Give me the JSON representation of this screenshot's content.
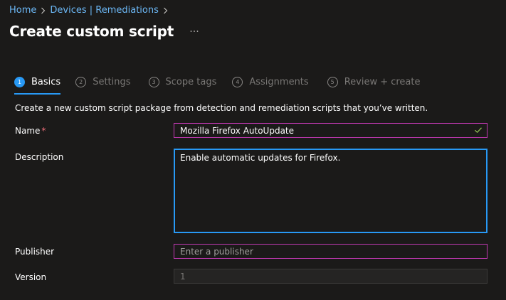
{
  "breadcrumb": {
    "items": [
      "Home",
      "Devices | Remediations"
    ]
  },
  "page": {
    "title": "Create custom script",
    "more_label": "···"
  },
  "tabs": [
    {
      "number": "1",
      "label": "Basics",
      "active": true
    },
    {
      "number": "2",
      "label": "Settings",
      "active": false
    },
    {
      "number": "3",
      "label": "Scope tags",
      "active": false
    },
    {
      "number": "4",
      "label": "Assignments",
      "active": false
    },
    {
      "number": "5",
      "label": "Review + create",
      "active": false
    }
  ],
  "intro": "Create a new custom script package from detection and remediation scripts that you’ve written.",
  "form": {
    "name": {
      "label": "Name",
      "required_mark": "*",
      "value": "Mozilla Firefox AutoUpdate"
    },
    "description": {
      "label": "Description",
      "value": "Enable automatic updates for Firefox."
    },
    "publisher": {
      "label": "Publisher",
      "value": "",
      "placeholder": "Enter a publisher"
    },
    "version": {
      "label": "Version",
      "value": "1"
    }
  },
  "colors": {
    "background": "#1b1a19",
    "link": "#6cb8f6",
    "accent": "#2899f5",
    "field_border_focus": "#c239b3",
    "required": "#f1707b",
    "valid_check": "#92c353"
  }
}
